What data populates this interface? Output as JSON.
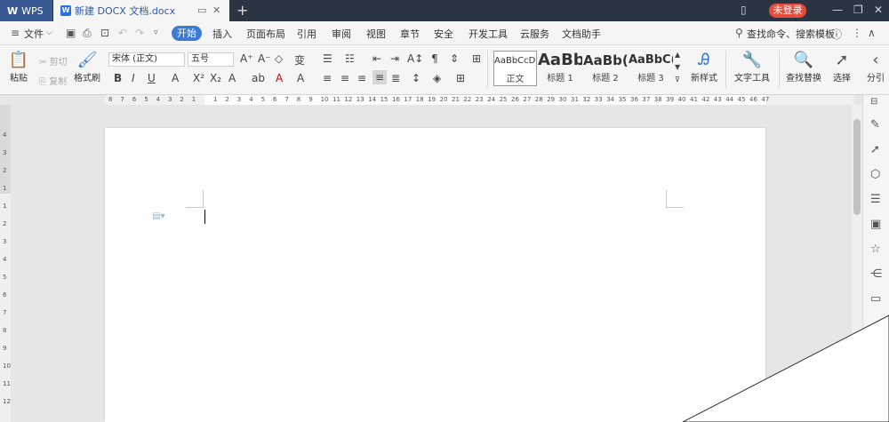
{
  "titlebar": {
    "app_label": "WPS",
    "doc_tab_title": "新建 DOCX 文档.docx",
    "doc_icon": "W",
    "login_label": "未登录"
  },
  "menubar": {
    "file_label": "文件",
    "items": [
      "开始",
      "插入",
      "页面布局",
      "引用",
      "审阅",
      "视图",
      "章节",
      "安全",
      "开发工具",
      "云服务",
      "文档助手"
    ],
    "search_label": "查找命令、搜索模板"
  },
  "ribbon": {
    "paste_label": "粘贴",
    "cut_label": "剪切",
    "copy_label": "复制",
    "format_painter_label": "格式刷",
    "font_name": "宋体 (正文)",
    "font_size": "五号",
    "styles": [
      {
        "sample": "AaBbCcDd",
        "name": "正文"
      },
      {
        "sample": "AaBb",
        "name": "标题 1"
      },
      {
        "sample": "AaBb(",
        "name": "标题 2"
      },
      {
        "sample": "AaBbC(",
        "name": "标题 3"
      }
    ],
    "new_style_label": "新样式",
    "text_tool_label": "文字工具",
    "find_replace_label": "查找替换",
    "select_label": "选择",
    "more_label": "分引"
  },
  "ruler": {
    "left_ticks": [
      "8",
      "7",
      "6",
      "5",
      "4",
      "3",
      "2",
      "1"
    ],
    "right_ticks": [
      "1",
      "2",
      "3",
      "4",
      "5",
      "6",
      "7",
      "8",
      "9",
      "10",
      "11",
      "12",
      "13",
      "14",
      "15",
      "16",
      "17",
      "18",
      "19",
      "20",
      "21",
      "22",
      "23",
      "24",
      "25",
      "26",
      "27",
      "28",
      "29",
      "30",
      "31",
      "32",
      "33",
      "34",
      "35",
      "36",
      "37",
      "38",
      "39",
      "40",
      "41",
      "42",
      "43",
      "44",
      "45",
      "46",
      "47"
    ]
  },
  "vruler": {
    "ticks": [
      "4",
      "3",
      "2",
      "1",
      "1",
      "2",
      "3",
      "4",
      "5",
      "6",
      "7",
      "8",
      "9",
      "10",
      "11",
      "12"
    ]
  }
}
